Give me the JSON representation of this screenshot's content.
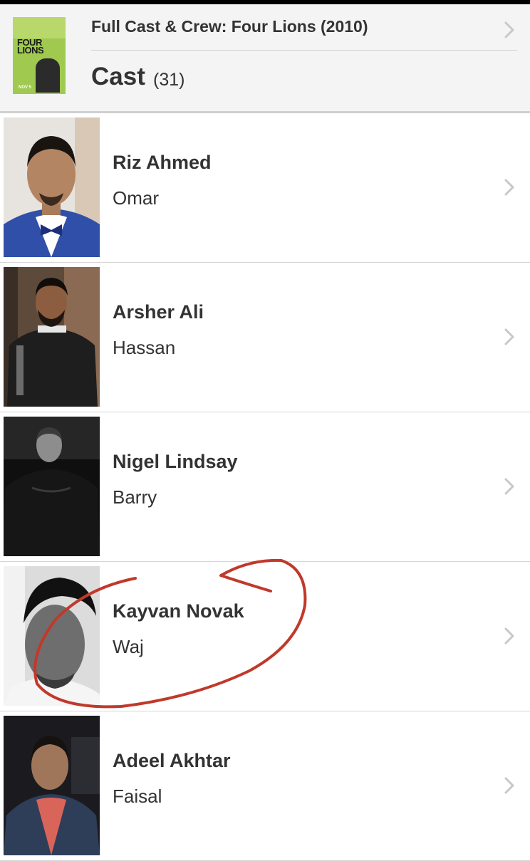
{
  "header": {
    "poster_text": {
      "title": "FOUR LIONS",
      "date": "NOV 5"
    },
    "breadcrumb": "Full Cast & Crew: Four Lions (2010)",
    "section_title": "Cast",
    "section_count": "(31)"
  },
  "cast": [
    {
      "actor": "Riz Ahmed",
      "role": "Omar"
    },
    {
      "actor": "Arsher Ali",
      "role": "Hassan"
    },
    {
      "actor": "Nigel Lindsay",
      "role": "Barry"
    },
    {
      "actor": "Kayvan Novak",
      "role": "Waj"
    },
    {
      "actor": "Adeel Akhtar",
      "role": "Faisal"
    }
  ],
  "colors": {
    "header_bg": "#f4f4f4",
    "text": "#333333",
    "chevron": "#c7c7cc",
    "annotation": "#c0392b"
  },
  "icons": {
    "chevron": "chevron-right-icon"
  }
}
